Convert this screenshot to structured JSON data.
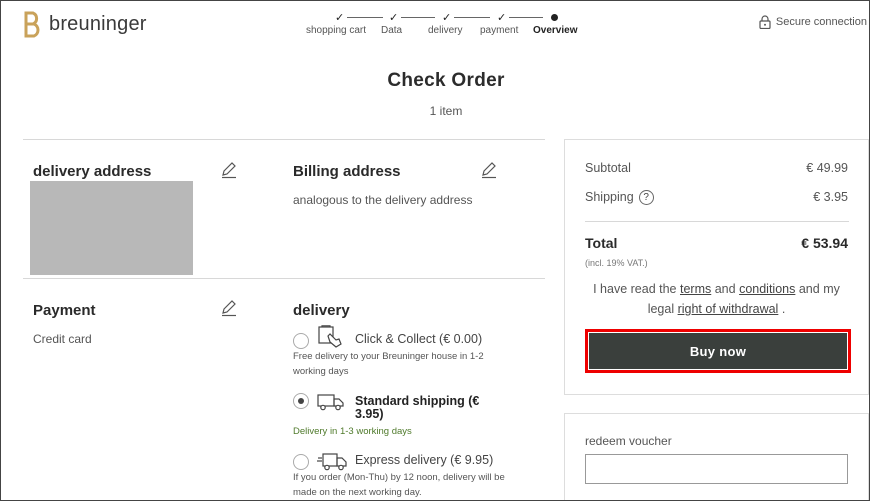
{
  "header": {
    "brand": "breuninger",
    "secure_label": "Secure connection",
    "steps": [
      {
        "label": "shopping cart",
        "done": true
      },
      {
        "label": "Data",
        "done": true
      },
      {
        "label": "delivery",
        "done": true
      },
      {
        "label": "payment",
        "done": true
      },
      {
        "label": "Overview",
        "done": false,
        "active": true
      }
    ]
  },
  "page": {
    "title": "Check Order",
    "item_count": "1 item"
  },
  "delivery_address": {
    "title": "delivery address"
  },
  "billing": {
    "title": "Billing address",
    "text": "analogous to the delivery address"
  },
  "payment": {
    "title": "Payment",
    "method": "Credit card"
  },
  "delivery": {
    "title": "delivery",
    "options": [
      {
        "label": "Click & Collect (€ 0.00)",
        "note": "Free delivery to your Breuninger house in 1-2 working days",
        "selected": false,
        "icon": "click-collect-icon"
      },
      {
        "label": "Standard shipping (€ 3.95)",
        "note": "Delivery in 1-3 working days",
        "selected": true,
        "icon": "truck-icon"
      },
      {
        "label": "Express delivery (€ 9.95)",
        "note": "If you order (Mon-Thu) by 12 noon, delivery will be made on the next working day.",
        "selected": false,
        "icon": "express-truck-icon"
      }
    ]
  },
  "summary": {
    "subtotal_label": "Subtotal",
    "subtotal_value": "€ 49.99",
    "shipping_label": "Shipping",
    "shipping_info": "?",
    "shipping_value": "€ 3.95",
    "total_label": "Total",
    "total_value": "€ 53.94",
    "vat_note": "(incl. 19% VAT.)",
    "terms_pre": "I have read the",
    "terms_link": "terms",
    "terms_and": "and",
    "conditions_link": "conditions",
    "terms_and2": "and",
    "terms_mid": "my legal",
    "withdrawal_link": "right of withdrawal",
    "terms_end": ".",
    "buy_label": "Buy now"
  },
  "voucher": {
    "label": "redeem voucher",
    "value": ""
  },
  "colors": {
    "buy_button": "#3a3f3c",
    "highlight": "#ee0000",
    "brand_gold": "#c9a25a",
    "green_note": "#4f7a2b"
  }
}
